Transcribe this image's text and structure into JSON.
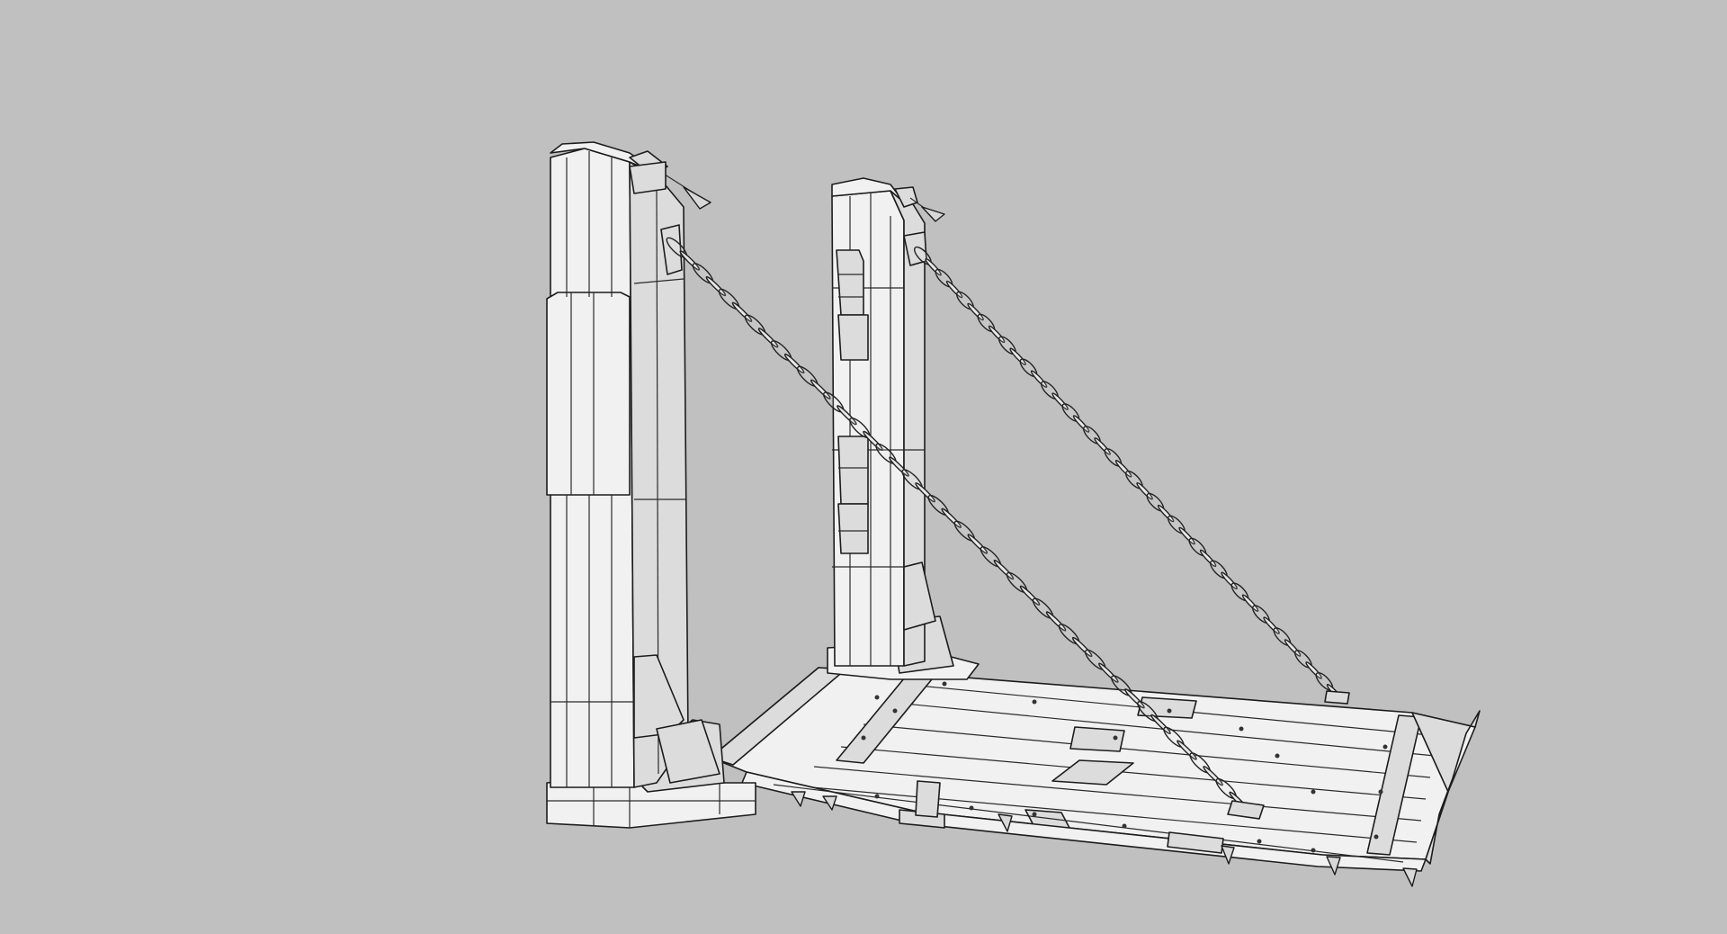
{
  "scene": {
    "subject": "drawbridge-wireframe-model",
    "background_color": "#c0c0c0",
    "surface_color": "#f1f1f1",
    "edge_color": "#1c1c1c",
    "chains": [
      {
        "name": "left-chain",
        "links": 44
      },
      {
        "name": "right-chain",
        "links": 40
      }
    ]
  }
}
